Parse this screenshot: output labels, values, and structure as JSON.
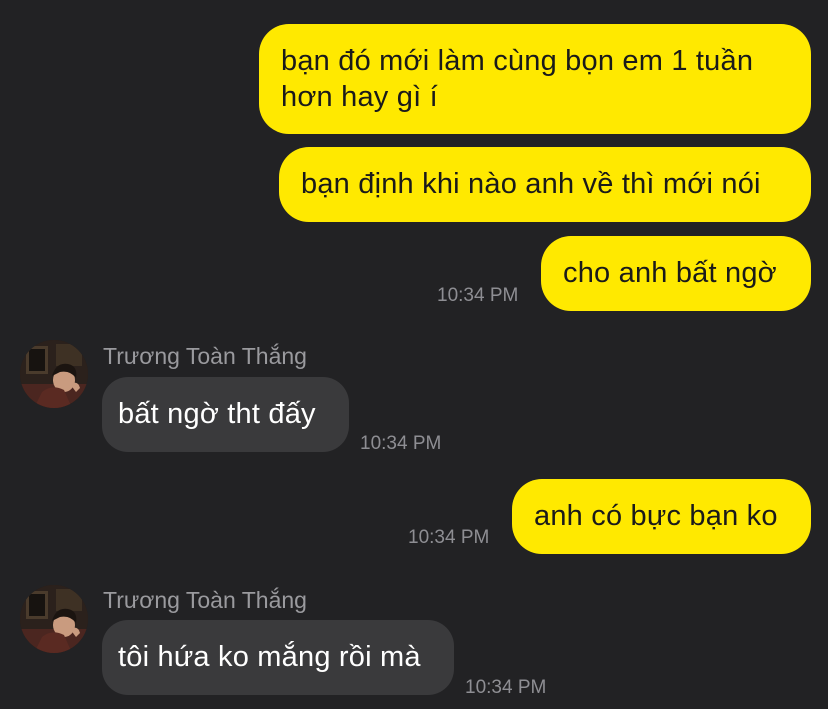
{
  "messages": [
    {
      "direction": "outgoing",
      "text": "bạn đó mới làm cùng bọn em 1 tuần hơn hay gì í"
    },
    {
      "direction": "outgoing",
      "text": "bạn định khi nào anh về thì mới nói"
    },
    {
      "direction": "outgoing",
      "text": "cho anh bất ngờ",
      "time": "10:34 PM"
    },
    {
      "direction": "incoming",
      "sender": "Trương Toàn Thắng",
      "avatar_icon": "user-avatar",
      "text": "bất ngờ tht đấy",
      "time": "10:34 PM"
    },
    {
      "direction": "outgoing",
      "text": "anh có bực bạn ko",
      "time": "10:34 PM"
    },
    {
      "direction": "incoming",
      "sender": "Trương Toàn Thắng",
      "avatar_icon": "user-avatar",
      "text": "tôi hứa ko mắng rồi mà",
      "time": "10:34 PM"
    }
  ],
  "colors": {
    "background": "#222224",
    "outgoing_bubble": "#FFE900",
    "incoming_bubble": "#3a3a3c",
    "timestamp": "#8e8e93",
    "sender_name": "#9a9a9e"
  }
}
